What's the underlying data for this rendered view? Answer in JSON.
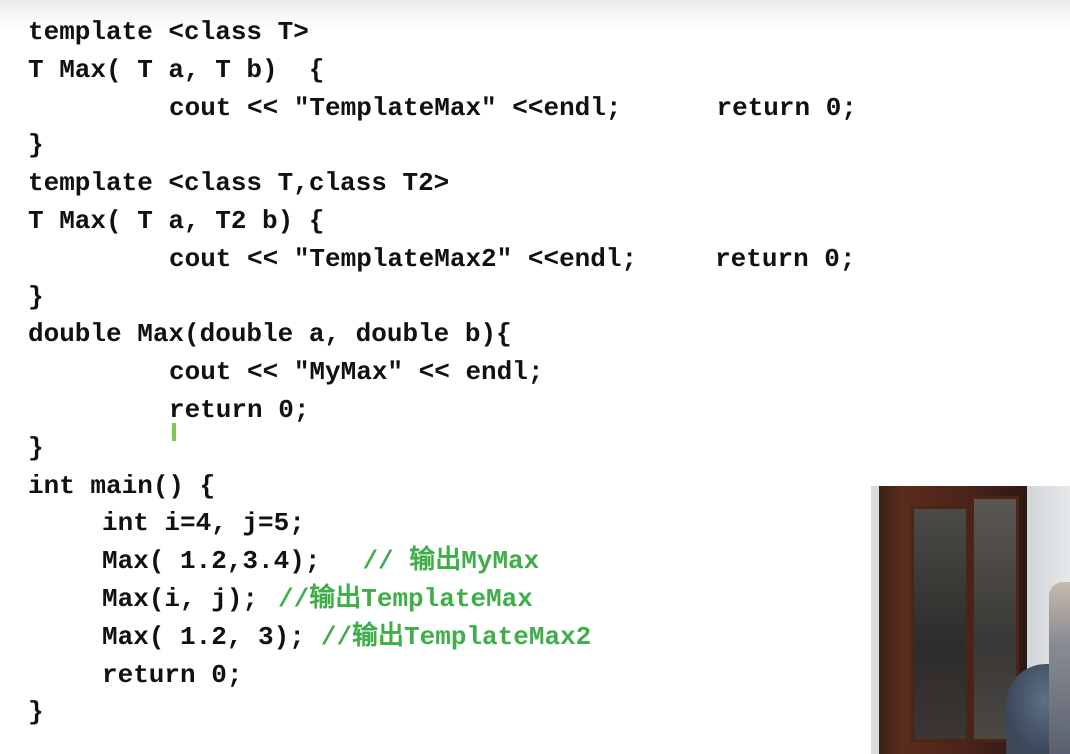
{
  "code": {
    "l1": "template <class T>",
    "l2": "T Max( T a, T b)  {",
    "l3a": "cout << \"TemplateMax\" <<endl;",
    "l3b": "return 0;",
    "l4": "}",
    "l5": "template <class T,class T2>",
    "l6": "T Max( T a, T2 b) {",
    "l7a": "cout << \"TemplateMax2\" <<endl;",
    "l7b": "return 0;",
    "l8": "}",
    "l9": "double Max(double a, double b){",
    "l10": "cout << \"MyMax\" << endl;",
    "l11": "return 0;",
    "l12": "}",
    "l13": "int main() {",
    "l14": "int i=4, j=5;",
    "l15a": "Max( 1.2,3.4);",
    "l15b": "// 输出MyMax",
    "l16a": "Max(i, j);",
    "l16b": "//输出TemplateMax",
    "l17a": "Max( 1.2, 3);",
    "l17b": "//输出TemplateMax2",
    "l18": "return 0;",
    "l19": "}"
  },
  "colors": {
    "code_text": "#111111",
    "comment": "#3fae4a",
    "cursor": "#7ec850"
  }
}
